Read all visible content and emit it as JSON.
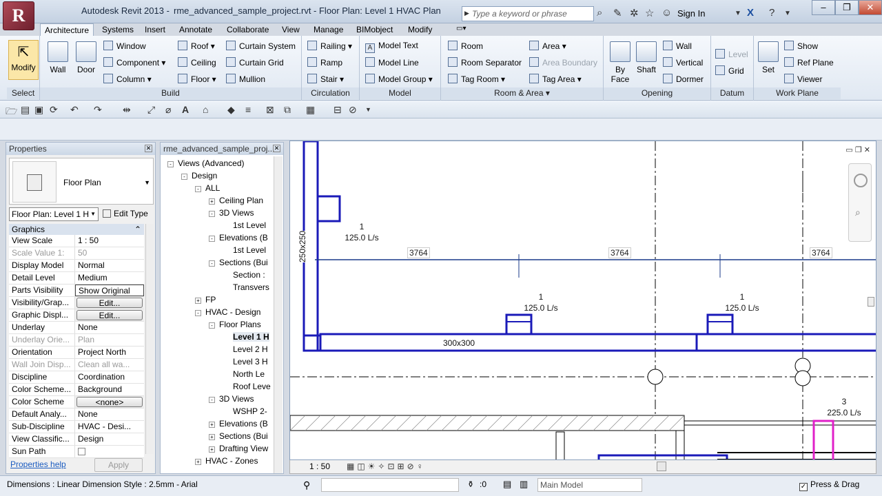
{
  "title": {
    "app": "Autodesk Revit 2013 -",
    "document": "rme_advanced_sample_project.rvt - Floor Plan: Level 1 HVAC Plan"
  },
  "search": {
    "placeholder": "Type a keyword or phrase"
  },
  "account": {
    "signin": "Sign In"
  },
  "tabs": [
    "Architecture",
    "Systems",
    "Insert",
    "Annotate",
    "Collaborate",
    "View",
    "Manage",
    "BIMobject",
    "Modify"
  ],
  "ribbon": {
    "select": {
      "modify": "Modify",
      "label": "Select"
    },
    "build": {
      "wall": "Wall",
      "door": "Door",
      "window": "Window",
      "component": "Component",
      "column": "Column",
      "roof": "Roof",
      "ceiling": "Ceiling",
      "floor": "Floor",
      "curtain_system": "Curtain System",
      "curtain_grid": "Curtain Grid",
      "mullion": "Mullion",
      "label": "Build"
    },
    "circulation": {
      "railing": "Railing",
      "ramp": "Ramp",
      "stair": "Stair",
      "label": "Circulation"
    },
    "model": {
      "text": "Model Text",
      "line": "Model Line",
      "group": "Model Group",
      "label": "Model"
    },
    "room": {
      "room": "Room",
      "separator": "Room Separator",
      "tag_room": "Tag Room",
      "area": "Area",
      "area_boundary": "Area Boundary",
      "tag_area": "Tag Area",
      "label": "Room & Area"
    },
    "opening": {
      "by_face_1": "By",
      "by_face_2": "Face",
      "shaft": "Shaft",
      "wall": "Wall",
      "vertical": "Vertical",
      "dormer": "Dormer",
      "label": "Opening"
    },
    "datum": {
      "level": "Level",
      "grid": "Grid",
      "label": "Datum"
    },
    "workplane": {
      "set": "Set",
      "show": "Show",
      "ref_plane": "Ref Plane",
      "viewer": "Viewer",
      "label": "Work Plane"
    }
  },
  "properties": {
    "title": "Properties",
    "type_name": "Floor Plan",
    "instance": "Floor Plan: Level 1 H",
    "edit_type": "Edit Type",
    "group": "Graphics",
    "rows": [
      {
        "k": "View Scale",
        "v": "1 : 50",
        "ro": false,
        "kind": "text"
      },
      {
        "k": "Scale Value    1:",
        "v": "50",
        "ro": true,
        "kind": "text"
      },
      {
        "k": "Display Model",
        "v": "Normal",
        "ro": false,
        "kind": "text"
      },
      {
        "k": "Detail Level",
        "v": "Medium",
        "ro": false,
        "kind": "text"
      },
      {
        "k": "Parts Visibility",
        "v": "Show Original",
        "ro": false,
        "kind": "box"
      },
      {
        "k": "Visibility/Grap...",
        "v": "Edit...",
        "ro": false,
        "kind": "btn"
      },
      {
        "k": "Graphic Displ...",
        "v": "Edit...",
        "ro": false,
        "kind": "btn"
      },
      {
        "k": "Underlay",
        "v": "None",
        "ro": false,
        "kind": "text"
      },
      {
        "k": "Underlay Orie...",
        "v": "Plan",
        "ro": true,
        "kind": "text"
      },
      {
        "k": "Orientation",
        "v": "Project North",
        "ro": false,
        "kind": "text"
      },
      {
        "k": "Wall Join Disp...",
        "v": "Clean all wa...",
        "ro": true,
        "kind": "text"
      },
      {
        "k": "Discipline",
        "v": "Coordination",
        "ro": false,
        "kind": "text"
      },
      {
        "k": "Color Scheme...",
        "v": "Background",
        "ro": false,
        "kind": "text"
      },
      {
        "k": "Color Scheme",
        "v": "<none>",
        "ro": false,
        "kind": "btn"
      },
      {
        "k": "Default Analy...",
        "v": "None",
        "ro": false,
        "kind": "text"
      },
      {
        "k": "Sub-Discipline",
        "v": "HVAC - Desi...",
        "ro": false,
        "kind": "text"
      },
      {
        "k": "View Classific...",
        "v": "Design",
        "ro": false,
        "kind": "text"
      },
      {
        "k": "Sun Path",
        "v": "",
        "ro": false,
        "kind": "check"
      }
    ],
    "help": "Properties help",
    "apply": "Apply"
  },
  "browser": {
    "title": "rme_advanced_sample_proj...",
    "items": [
      {
        "t": "Views (Advanced)",
        "lvl": 0,
        "tog": "-"
      },
      {
        "t": "Design",
        "lvl": 1,
        "tog": "-"
      },
      {
        "t": "ALL",
        "lvl": 2,
        "tog": "-"
      },
      {
        "t": "Ceiling Plan",
        "lvl": 3,
        "tog": "+"
      },
      {
        "t": "3D Views",
        "lvl": 3,
        "tog": "-"
      },
      {
        "t": "1st Level",
        "lvl": 4,
        "tog": ""
      },
      {
        "t": "Elevations (B",
        "lvl": 3,
        "tog": "-"
      },
      {
        "t": "1st Level",
        "lvl": 4,
        "tog": ""
      },
      {
        "t": "Sections (Bui",
        "lvl": 3,
        "tog": "-"
      },
      {
        "t": "Section :",
        "lvl": 4,
        "tog": ""
      },
      {
        "t": "Transvers",
        "lvl": 4,
        "tog": ""
      },
      {
        "t": "FP",
        "lvl": 2,
        "tog": "+"
      },
      {
        "t": "HVAC - Design",
        "lvl": 2,
        "tog": "-"
      },
      {
        "t": "Floor Plans",
        "lvl": 3,
        "tog": "-"
      },
      {
        "t": "Level 1 H",
        "lvl": 4,
        "tog": "",
        "sel": true
      },
      {
        "t": "Level 2 H",
        "lvl": 4,
        "tog": ""
      },
      {
        "t": "Level 3 H",
        "lvl": 4,
        "tog": ""
      },
      {
        "t": "North Le",
        "lvl": 4,
        "tog": ""
      },
      {
        "t": "Roof Leve",
        "lvl": 4,
        "tog": ""
      },
      {
        "t": "3D Views",
        "lvl": 3,
        "tog": "-"
      },
      {
        "t": "WSHP 2-",
        "lvl": 4,
        "tog": ""
      },
      {
        "t": "Elevations (B",
        "lvl": 3,
        "tog": "+"
      },
      {
        "t": "Sections (Bui",
        "lvl": 3,
        "tog": "+"
      },
      {
        "t": "Drafting View",
        "lvl": 3,
        "tog": "+"
      },
      {
        "t": "HVAC - Zones",
        "lvl": 2,
        "tog": "+"
      }
    ]
  },
  "drawing": {
    "dims": [
      "3764",
      "3764",
      "3764"
    ],
    "duct_main": "300x300",
    "duct_vert": "250x250",
    "terminals": [
      {
        "num": "1",
        "flow": "125.0 L/s"
      },
      {
        "num": "1",
        "flow": "125.0 L/s"
      },
      {
        "num": "1",
        "flow": "125.0 L/s"
      },
      {
        "num": "3",
        "flow": "225.0 L/s"
      }
    ]
  },
  "viewbar": {
    "scale": "1 : 50"
  },
  "status": {
    "text": "Dimensions : Linear Dimension Style : 2.5mm - Arial",
    "selcount": ":0",
    "model": "Main Model",
    "press_drag": "Press & Drag"
  }
}
